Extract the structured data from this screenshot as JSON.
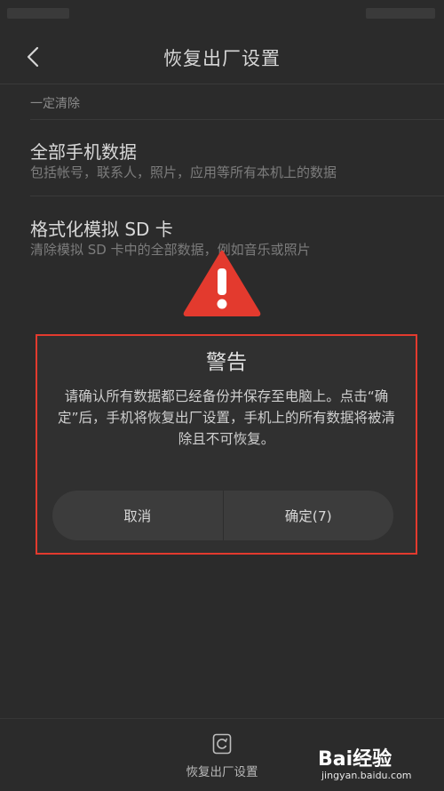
{
  "header": {
    "title": "恢复出厂设置",
    "back_icon": "chevron-left-icon"
  },
  "section": {
    "label": "一定清除"
  },
  "options": [
    {
      "title": "全部手机数据",
      "desc": "包括帐号，联系人，照片，应用等所有本机上的数据"
    },
    {
      "title": "格式化模拟 SD 卡",
      "desc": "清除模拟 SD 卡中的全部数据，例如音乐或照片"
    }
  ],
  "warning_icon": {
    "name": "warning-triangle-icon",
    "color": "#e33a2e"
  },
  "dialog": {
    "title": "警告",
    "message": "请确认所有数据都已经备份并保存至电脑上。点击“确定”后，手机将恢复出厂设置，手机上的所有数据将被清除且不可恢复。",
    "cancel_label": "取消",
    "confirm_label": "确定(7)",
    "border_color": "#e33a2e"
  },
  "bottom_bar": {
    "label": "恢复出厂设置",
    "icon": "reset-icon"
  },
  "watermark": {
    "logo": "Bai经验",
    "site": "jingyan.baidu.com"
  }
}
